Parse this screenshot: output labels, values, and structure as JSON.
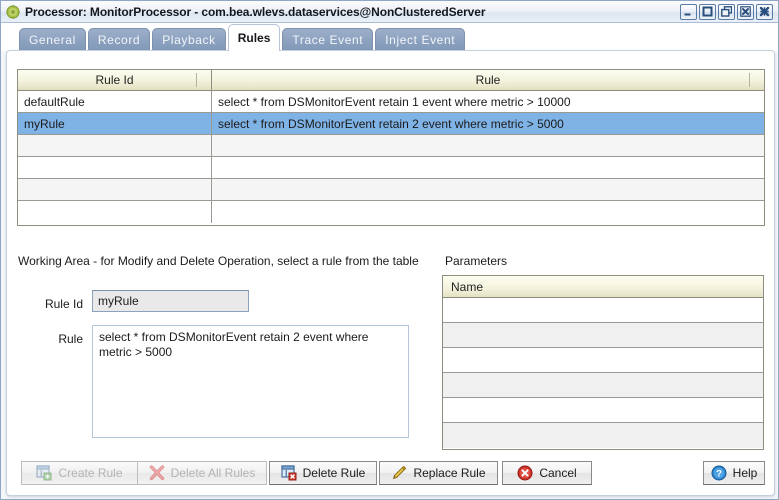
{
  "window": {
    "title": "Processor: MonitorProcessor - com.bea.wlevs.dataservices@NonClusteredServer",
    "app_icon": "gear-icon",
    "controls": [
      {
        "name": "minimize-button",
        "glyph": "minimize-icon"
      },
      {
        "name": "maximize-button",
        "glyph": "maximize-icon"
      },
      {
        "name": "restore-button",
        "glyph": "restore-icon"
      },
      {
        "name": "close-frame-button",
        "glyph": "close-boxed-icon"
      },
      {
        "name": "close-window-button",
        "glyph": "close-icon"
      }
    ]
  },
  "tabs": [
    {
      "label": "General",
      "selected": false
    },
    {
      "label": "Record",
      "selected": false
    },
    {
      "label": "Playback",
      "selected": false
    },
    {
      "label": "Rules",
      "selected": true
    },
    {
      "label": "Trace Event",
      "selected": false
    },
    {
      "label": "Inject Event",
      "selected": false
    }
  ],
  "rules_table": {
    "columns": [
      "Rule Id",
      "Rule"
    ],
    "rows": [
      {
        "rule_id": "defaultRule",
        "rule": "select * from DSMonitorEvent retain 1 event where metric > 10000",
        "selected": false
      },
      {
        "rule_id": "myRule",
        "rule": "select * from DSMonitorEvent retain 2 event where metric > 5000",
        "selected": true
      },
      {
        "rule_id": "",
        "rule": "",
        "selected": false
      },
      {
        "rule_id": "",
        "rule": "",
        "selected": false
      },
      {
        "rule_id": "",
        "rule": "",
        "selected": false
      },
      {
        "rule_id": "",
        "rule": "",
        "selected": false
      }
    ]
  },
  "working_area": {
    "heading": "Working Area - for Modify and Delete Operation, select a rule from the table",
    "rule_id_label": "Rule Id",
    "rule_id_value": "myRule",
    "rule_label": "Rule",
    "rule_value": "select * from DSMonitorEvent retain 2 event where metric > 5000"
  },
  "parameters": {
    "heading": "Parameters",
    "columns": [
      "Name"
    ],
    "rows": [
      "",
      "",
      "",
      "",
      "",
      ""
    ]
  },
  "buttons": {
    "create_rule": {
      "label": "Create Rule",
      "icon": "new-window-add-icon",
      "enabled": false
    },
    "delete_all_rules": {
      "label": "Delete All Rules",
      "icon": "red-x-icon",
      "enabled": false
    },
    "delete_rule": {
      "label": "Delete Rule",
      "icon": "window-delete-icon",
      "enabled": true
    },
    "replace_rule": {
      "label": "Replace Rule",
      "icon": "pencil-icon",
      "enabled": true
    },
    "cancel": {
      "label": "Cancel",
      "icon": "cancel-circle-icon",
      "enabled": true
    },
    "help": {
      "label": "Help",
      "icon": "help-circle-icon",
      "enabled": true
    }
  },
  "colors": {
    "selection": "#7fb2e5",
    "tab_inactive": "#8ea3c0",
    "table_header": "#f7f6e2",
    "title_text": "#13181f"
  }
}
